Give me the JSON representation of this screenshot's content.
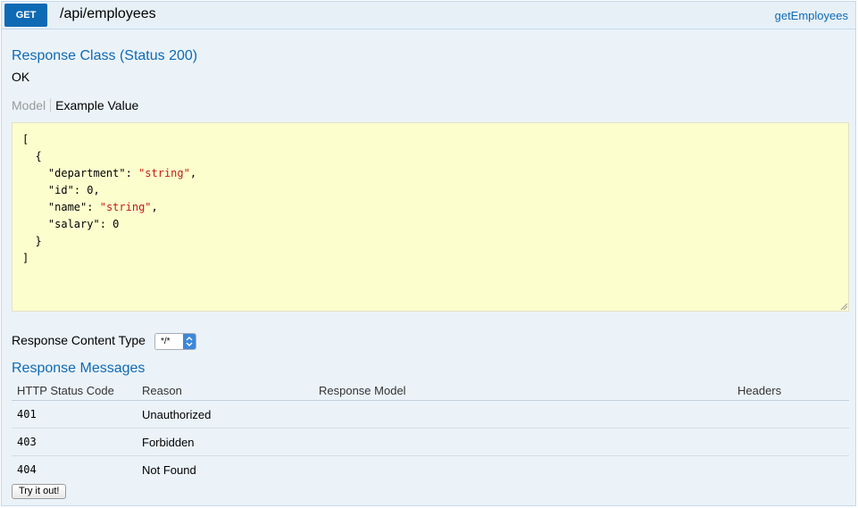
{
  "operation": {
    "method": "GET",
    "path": "/api/employees",
    "operation_id": "getEmployees"
  },
  "response_class": {
    "heading": "Response Class (Status 200)",
    "description": "OK"
  },
  "signature_tabs": {
    "model": "Model",
    "example": "Example Value"
  },
  "example": {
    "open_bracket": "[",
    "open_brace": "{",
    "fields": [
      {
        "key": "\"department\"",
        "value": "\"string\"",
        "type": "string",
        "comma": ","
      },
      {
        "key": "\"id\"",
        "value": "0",
        "type": "number",
        "comma": ","
      },
      {
        "key": "\"name\"",
        "value": "\"string\"",
        "type": "string",
        "comma": ","
      },
      {
        "key": "\"salary\"",
        "value": "0",
        "type": "number",
        "comma": ""
      }
    ],
    "close_brace": "}",
    "close_bracket": "]"
  },
  "content_type": {
    "label": "Response Content Type",
    "selected": "*/*"
  },
  "response_messages": {
    "heading": "Response Messages",
    "columns": [
      "HTTP Status Code",
      "Reason",
      "Response Model",
      "Headers"
    ],
    "rows": [
      {
        "code": "401",
        "reason": "Unauthorized",
        "model": "",
        "headers": ""
      },
      {
        "code": "403",
        "reason": "Forbidden",
        "model": "",
        "headers": ""
      },
      {
        "code": "404",
        "reason": "Not Found",
        "model": "",
        "headers": ""
      }
    ]
  },
  "try_button": "Try it out!",
  "colors": {
    "method_badge": "#0f6ab4",
    "heading": "#0f6ab4",
    "panel_bg": "#ebf3f9",
    "snippet_bg": "#fcffcd",
    "string_value": "#c41a16"
  }
}
